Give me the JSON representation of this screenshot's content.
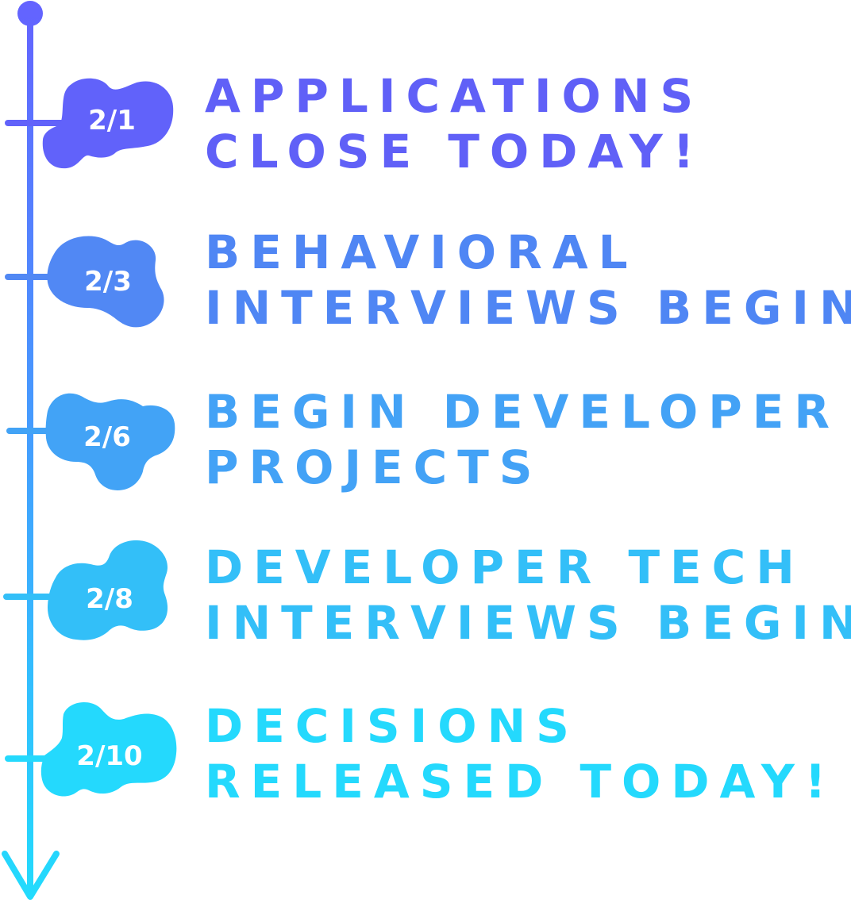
{
  "timeline": {
    "gradient_start": "#6462FF",
    "gradient_end": "#22DCFD",
    "events": [
      {
        "date": "2/1",
        "line1": "APPLICATIONS",
        "line2": "CLOSE TODAY!",
        "color": "#6060F7"
      },
      {
        "date": "2/3",
        "line1": "BEHAVIORAL",
        "line2": "INTERVIEWS BEGIN",
        "color": "#4F86F4"
      },
      {
        "date": "2/6",
        "line1": "BEGIN DEVELOPER",
        "line2": "PROJECTS",
        "color": "#43A2F6"
      },
      {
        "date": "2/8",
        "line1": "DEVELOPER TECH",
        "line2": "INTERVIEWS BEGIN",
        "color": "#33BFF8"
      },
      {
        "date": "2/10",
        "line1": "DECISIONS",
        "line2": "RELEASED TODAY!",
        "color": "#24D9FD"
      }
    ]
  }
}
